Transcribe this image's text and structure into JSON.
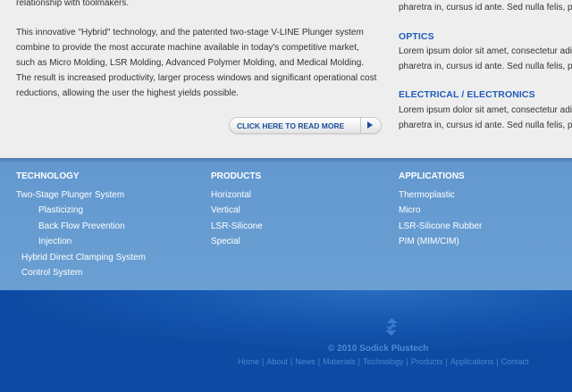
{
  "left_column": {
    "intro_tail": "relationship with toolmakers.",
    "paragraph_lines": [
      "This innovative \"Hybrid\" technology, and the patented two-stage V-LINE Plunger system",
      "combine to provide the most accurate machine available in today's competitive market,",
      "such as Micro Molding, LSR Molding, Advanced Polymer Molding, and Medical Molding.",
      "The result is increased productivity, larger process windows and significant operational cost",
      "reductions, allowing the user the highest yields possible."
    ],
    "read_more_label": "CLICK HERE TO READ MORE"
  },
  "right_column": {
    "top_line": "pharetra in, cursus id ante. Sed nulla felis, p",
    "sections": [
      {
        "heading": "OPTICS",
        "lines": [
          "Lorem ipsum dolor sit amet, consectetur adi",
          "pharetra in, cursus id ante. Sed nulla felis, p"
        ]
      },
      {
        "heading": "ELECTRICAL / ELECTRONICS",
        "lines": [
          "Lorem ipsum dolor sit amet, consectetur adi",
          "pharetra in, cursus id ante. Sed nulla felis, p"
        ]
      }
    ]
  },
  "footer_nav": {
    "technology": {
      "heading": "TECHNOLOGY",
      "links": [
        "Two-Stage Plunger System",
        "Plasticizing",
        "Back Flow Prevention",
        "Injection",
        "Hybrid Direct Clamping System",
        "Control System"
      ]
    },
    "products": {
      "heading": "PRODUCTS",
      "links": [
        "Horizontal",
        "Vertical",
        "LSR-Silicone",
        "Special"
      ]
    },
    "applications": {
      "heading": "APPLICATIONS",
      "links": [
        "Thermoplastic",
        "Micro",
        "LSR-Silicone Rubber",
        "PIM (MIM/CIM)"
      ]
    }
  },
  "bottom": {
    "logo_icon": "sodick-logo-icon",
    "copyright": "© 2010 Sodick Plustech",
    "links": [
      "Home",
      "About",
      "News",
      "Materials",
      "Technology",
      "Products",
      "Applications",
      "Contact"
    ],
    "separator": "|"
  },
  "colors": {
    "heading_blue": "#1f5cbb",
    "footer_nav_bg": "#6399d0",
    "bottom_bg": "#0d4aa3",
    "bottom_text": "#4c86d0"
  }
}
